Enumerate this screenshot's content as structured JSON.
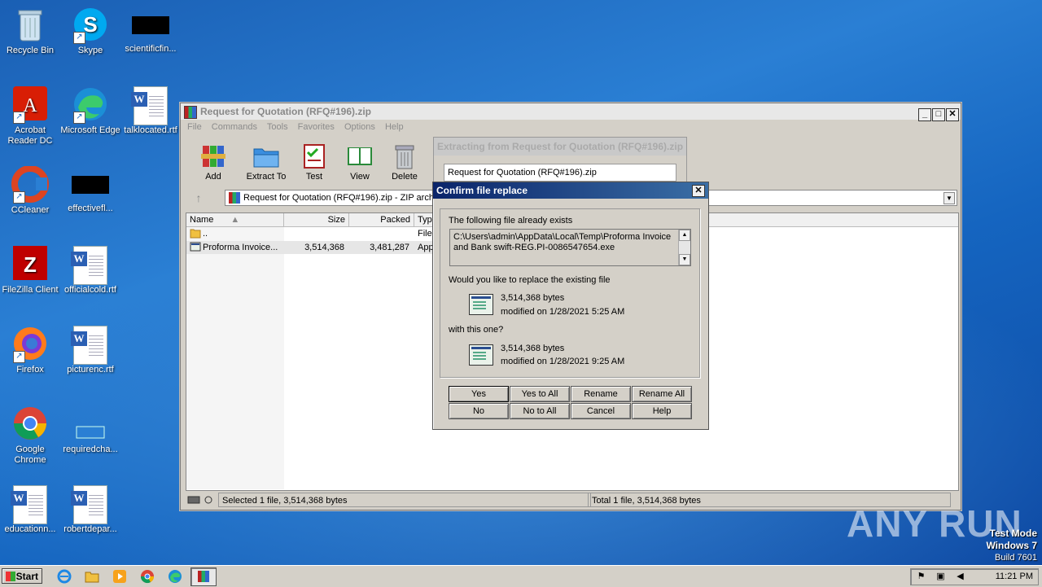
{
  "desktop": {
    "icons": [
      {
        "label": "Recycle Bin"
      },
      {
        "label": "Skype"
      },
      {
        "label": "scientificfin..."
      },
      {
        "label": "Acrobat Reader DC"
      },
      {
        "label": "Microsoft Edge"
      },
      {
        "label": "talklocated.rtf"
      },
      {
        "label": "CCleaner"
      },
      {
        "label": "effectivefl..."
      },
      {
        "label": "FileZilla Client"
      },
      {
        "label": "officialcold.rtf"
      },
      {
        "label": "Firefox"
      },
      {
        "label": "picturenc.rtf"
      },
      {
        "label": "Google Chrome"
      },
      {
        "label": "requiredcha..."
      },
      {
        "label": "educationn..."
      },
      {
        "label": "robertdepar..."
      }
    ]
  },
  "winrar": {
    "title": "Request for Quotation (RFQ#196).zip",
    "menu": [
      "File",
      "Commands",
      "Tools",
      "Favorites",
      "Options",
      "Help"
    ],
    "toolbar": [
      "Add",
      "Extract To",
      "Test",
      "View",
      "Delete"
    ],
    "address": "Request for Quotation (RFQ#196).zip - ZIP arch",
    "columns": [
      "Name",
      "Size",
      "Packed",
      "Typ"
    ],
    "rows": [
      {
        "name": "..",
        "size": "",
        "packed": "",
        "type": "File"
      },
      {
        "name": "Proforma Invoice...",
        "size": "3,514,368",
        "packed": "3,481,287",
        "type": "App"
      }
    ],
    "status_left": "Selected 1 file, 3,514,368 bytes",
    "status_right": "Total 1 file, 3,514,368 bytes"
  },
  "extracting": {
    "title": "Extracting from Request for Quotation (RFQ#196).zip",
    "file": "Request for Quotation (RFQ#196).zip"
  },
  "confirm": {
    "title": "Confirm file replace",
    "exists_label": "The following file already exists",
    "path_line1": "C:\\Users\\admin\\AppData\\Local\\Temp\\Proforma Invoice",
    "path_line2": "and Bank swift-REG.PI-0086547654.exe",
    "question": "Would you like to replace the existing file",
    "existing_size": "3,514,368 bytes",
    "existing_modified": "modified on 1/28/2021 5:25 AM",
    "with_label": "with this one?",
    "new_size": "3,514,368 bytes",
    "new_modified": "modified on 1/28/2021 9:25 AM",
    "buttons": [
      "Yes",
      "Yes to All",
      "Rename",
      "Rename All",
      "No",
      "No to All",
      "Cancel",
      "Help"
    ]
  },
  "taskbar": {
    "start": "Start",
    "clock": "11:21 PM"
  },
  "watermark": "ANY RUN",
  "testmode": {
    "line1": "Test Mode",
    "line2": "Windows 7",
    "line3": "Build 7601"
  }
}
